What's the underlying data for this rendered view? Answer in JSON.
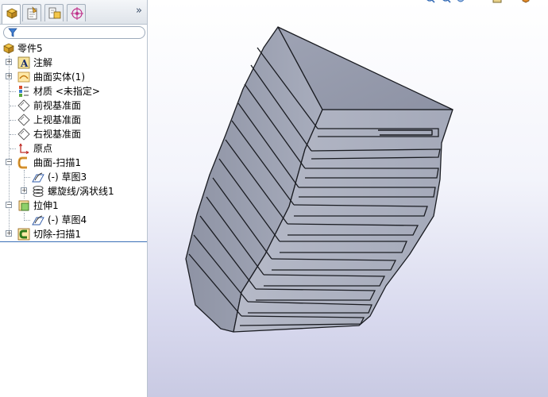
{
  "toolbar": {
    "tabs": [
      {
        "icon": "feature-manager-icon"
      },
      {
        "icon": "property-manager-icon"
      },
      {
        "icon": "configuration-manager-icon"
      },
      {
        "icon": "dimxpert-manager-icon"
      }
    ],
    "overflow_label": "»"
  },
  "tree": {
    "root": {
      "label": "零件5",
      "icon": "part-icon"
    },
    "items": [
      {
        "label": "注解",
        "icon": "annotations-icon",
        "expandable": true
      },
      {
        "label": "曲面实体(1)",
        "icon": "surface-bodies-icon",
        "expandable": true
      },
      {
        "label": "材质 <未指定>",
        "icon": "material-icon",
        "expandable": false
      },
      {
        "label": "前视基准面",
        "icon": "plane-icon",
        "expandable": false
      },
      {
        "label": "上视基准面",
        "icon": "plane-icon",
        "expandable": false
      },
      {
        "label": "右视基准面",
        "icon": "plane-icon",
        "expandable": false
      },
      {
        "label": "原点",
        "icon": "origin-icon",
        "expandable": false
      },
      {
        "label": "曲面-扫描1",
        "icon": "surface-sweep-icon",
        "expanded": true
      },
      {
        "label": "(-) 草图3",
        "icon": "sketch-icon",
        "child": true
      },
      {
        "label": "螺旋线/涡状线1",
        "icon": "helix-icon",
        "child": true,
        "expandable": true
      },
      {
        "label": "拉伸1",
        "icon": "extrude-icon",
        "expanded": true
      },
      {
        "label": "(-) 草图4",
        "icon": "sketch-icon",
        "child": true
      },
      {
        "label": "切除-扫描1",
        "icon": "cut-sweep-icon",
        "expandable": true
      }
    ]
  },
  "colors": {
    "accent": "#3a6fb7",
    "feature_orange": "#e9a23b",
    "sketch_blue": "#2e5aa8",
    "body_gray": "#9fa4b4"
  }
}
